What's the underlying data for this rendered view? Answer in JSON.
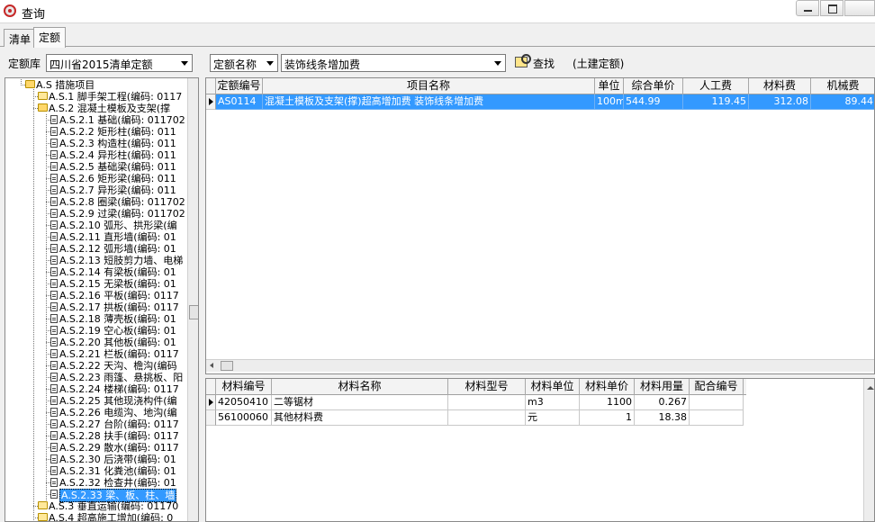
{
  "window": {
    "title": "查询"
  },
  "tabs": [
    {
      "label": "清单"
    },
    {
      "label": "定额"
    }
  ],
  "toolbar": {
    "library_label": "定额库",
    "library_value": "四川省2015清单定额",
    "field_value": "定额名称",
    "keyword_value": "装饰线条增加费",
    "search_label": "查找",
    "tag": "(土建定额)"
  },
  "tree": {
    "items": [
      {
        "label": "A.S 措施项目",
        "icon": "folder-open-icon"
      },
      {
        "label": "A.S.1 脚手架工程(编码: 0117",
        "icon": "folder-icon"
      },
      {
        "label": "A.S.2 混凝土模板及支架(撑",
        "icon": "folder-open-icon"
      },
      {
        "label": "A.S.2.1 基础(编码: 011702",
        "icon": "document-icon"
      },
      {
        "label": "A.S.2.2 矩形柱(编码: 011",
        "icon": "document-icon"
      },
      {
        "label": "A.S.2.3 构造柱(编码: 011",
        "icon": "document-icon"
      },
      {
        "label": "A.S.2.4 异形柱(编码: 011",
        "icon": "document-icon"
      },
      {
        "label": "A.S.2.5 基础梁(编码: 011",
        "icon": "document-icon"
      },
      {
        "label": "A.S.2.6 矩形梁(编码: 011",
        "icon": "document-icon"
      },
      {
        "label": "A.S.2.7 异形梁(编码: 011",
        "icon": "document-icon"
      },
      {
        "label": "A.S.2.8 圈梁(编码: 011702",
        "icon": "document-icon"
      },
      {
        "label": "A.S.2.9 过梁(编码: 011702",
        "icon": "document-icon"
      },
      {
        "label": "A.S.2.10 弧形、拱形梁(编",
        "icon": "document-icon"
      },
      {
        "label": "A.S.2.11 直形墙(编码: 01",
        "icon": "document-icon"
      },
      {
        "label": "A.S.2.12 弧形墙(编码: 01",
        "icon": "document-icon"
      },
      {
        "label": "A.S.2.13 短肢剪力墙、电梯",
        "icon": "document-icon"
      },
      {
        "label": "A.S.2.14 有梁板(编码: 01",
        "icon": "document-icon"
      },
      {
        "label": "A.S.2.15 无梁板(编码: 01",
        "icon": "document-icon"
      },
      {
        "label": "A.S.2.16 平板(编码: 0117",
        "icon": "document-icon"
      },
      {
        "label": "A.S.2.17 拱板(编码: 0117",
        "icon": "document-icon"
      },
      {
        "label": "A.S.2.18 薄壳板(编码: 01",
        "icon": "document-icon"
      },
      {
        "label": "A.S.2.19 空心板(编码: 01",
        "icon": "document-icon"
      },
      {
        "label": "A.S.2.20 其他板(编码: 01",
        "icon": "document-icon"
      },
      {
        "label": "A.S.2.21 栏板(编码: 0117",
        "icon": "document-icon"
      },
      {
        "label": "A.S.2.22 天沟、檐沟(编码",
        "icon": "document-icon"
      },
      {
        "label": "A.S.2.23 雨篷、悬挑板、阳",
        "icon": "document-icon"
      },
      {
        "label": "A.S.2.24 楼梯(编码: 0117",
        "icon": "document-icon"
      },
      {
        "label": "A.S.2.25 其他现浇构件(编",
        "icon": "document-icon"
      },
      {
        "label": "A.S.2.26 电缆沟、地沟(编",
        "icon": "document-icon"
      },
      {
        "label": "A.S.2.27 台阶(编码: 0117",
        "icon": "document-icon"
      },
      {
        "label": "A.S.2.28 扶手(编码: 0117",
        "icon": "document-icon"
      },
      {
        "label": "A.S.2.29 散水(编码: 0117",
        "icon": "document-icon"
      },
      {
        "label": "A.S.2.30 后浇带(编码: 01",
        "icon": "document-icon"
      },
      {
        "label": "A.S.2.31 化粪池(编码: 01",
        "icon": "document-icon"
      },
      {
        "label": "A.S.2.32 检查井(编码: 01",
        "icon": "document-icon"
      },
      {
        "label": "A.S.2.33 梁、板、柱、墙",
        "icon": "document-icon"
      },
      {
        "label": "A.S.3 垂直运输(编码: 01170",
        "icon": "folder-icon"
      },
      {
        "label": "A.S.4 超高施工增加(编码: 0",
        "icon": "folder-icon"
      }
    ],
    "selected_label": "A.S.2.33 梁、板、柱、墙"
  },
  "quota_grid": {
    "columns": [
      "定额编号",
      "项目名称",
      "单位",
      "综合单价",
      "人工费",
      "材料费",
      "机械费"
    ],
    "rows": [
      {
        "code": "AS0114",
        "name": "混凝土模板及支架(撑)超高增加费 装饰线条增加费",
        "unit": "100m",
        "price": "544.99",
        "labor": "119.45",
        "material": "312.08",
        "machine": "89.44"
      }
    ]
  },
  "material_grid": {
    "columns": [
      "材料编号",
      "材料名称",
      "材料型号",
      "材料单位",
      "材料单价",
      "材料用量",
      "配合编号"
    ],
    "rows": [
      {
        "code": "42050410",
        "name": "二等锯材",
        "model": "",
        "unit": "m3",
        "price": "1100",
        "qty": "0.267",
        "mix": ""
      },
      {
        "code": "56100060",
        "name": "其他材料费",
        "model": "",
        "unit": "元",
        "price": "1",
        "qty": "18.38",
        "mix": ""
      }
    ]
  },
  "colors": {
    "selection": "#3399ff",
    "header_bg": "#f3f3f3",
    "grid_line": "#c8c8c8"
  }
}
